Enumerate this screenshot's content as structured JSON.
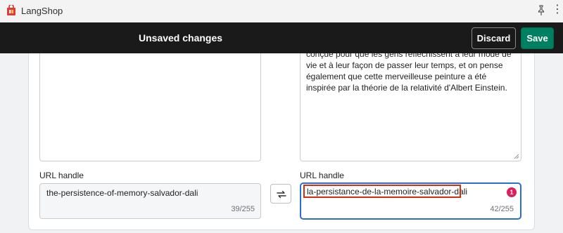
{
  "app": {
    "title": "LangShop",
    "more_label": "⋮"
  },
  "savebar": {
    "message": "Unsaved changes",
    "discard_label": "Discard",
    "save_label": "Save"
  },
  "description": {
    "translated_text": "conçue pour que les gens réfléchissent à leur mode de vie et à leur façon de passer leur temps, et on pense également que cette merveilleuse peinture a été inspirée par la théorie de la relativité d'Albert Einstein."
  },
  "url_handle": {
    "source_label": "URL handle",
    "source_value": "the-persistence-of-memory-salvador-dali",
    "source_count": "39/255",
    "target_label": "URL handle",
    "target_value": "la-persistance-de-la-memoire-salvador-dali",
    "target_count": "42/255",
    "warning_badge": "1"
  },
  "colors": {
    "accent_blue": "#2c6ecb",
    "save_green": "#008060",
    "badge_red": "#e01e5a",
    "highlight_red": "#d72c0d"
  }
}
